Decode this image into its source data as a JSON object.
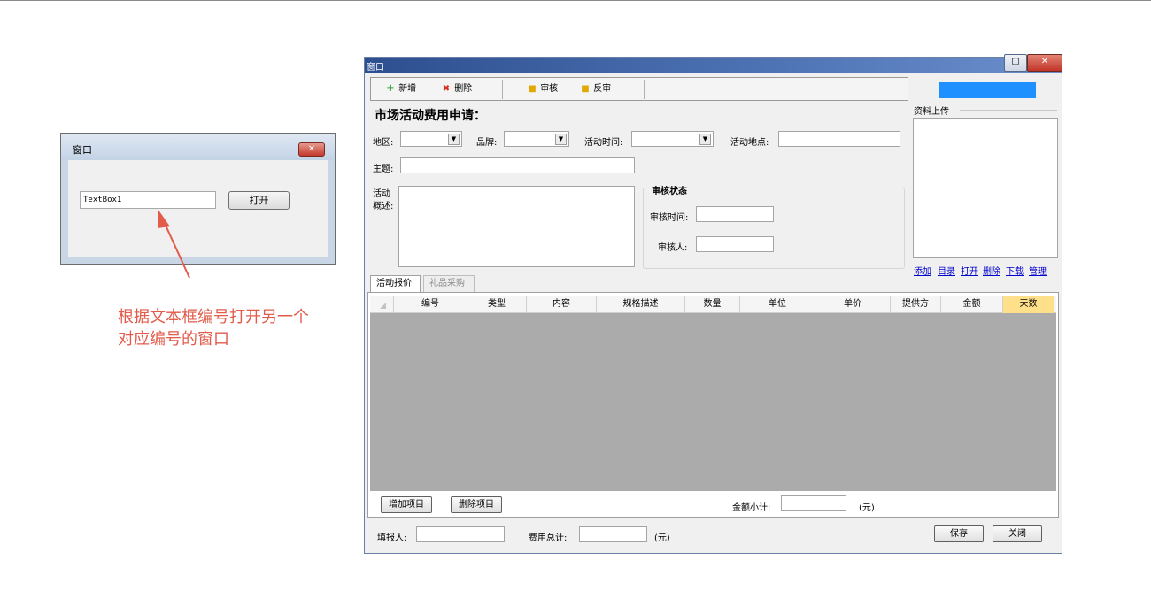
{
  "small_window": {
    "title": "窗口",
    "close": "✕",
    "textbox_value": "TextBox1",
    "open_button": "打开"
  },
  "annotation": {
    "line1": "根据文本框编号打开另一个",
    "line2": "对应编号的窗口",
    "color": "#e25b4b"
  },
  "main_window": {
    "title": "窗口",
    "max": "▢",
    "close": "✕",
    "toolbar": {
      "new": "新增",
      "delete": "删除",
      "audit": "审核",
      "unaudit": "反审"
    },
    "form_title": "市场活动费用申请：",
    "fields": {
      "region_label": "地区:",
      "brand_label": "品牌:",
      "time_label": "活动时间:",
      "place_label": "活动地点:",
      "subject_label": "主题:",
      "desc_label_1": "活动",
      "desc_label_2": "概述:"
    },
    "audit_group": {
      "title": "审核状态",
      "time_label": "审核时间:",
      "person_label": "审核人:"
    },
    "upload": {
      "label": "资料上传",
      "links": [
        "添加",
        "目录",
        "打开",
        "删除",
        "下载",
        "管理"
      ]
    },
    "tabs": [
      "活动报价",
      "礼品采购"
    ],
    "grid": {
      "columns": [
        "编号",
        "类型",
        "内容",
        "规格描述",
        "数量",
        "单位",
        "单价",
        "提供方",
        "金额",
        "天数"
      ]
    },
    "add_item": "增加项目",
    "delete_item": "删除项目",
    "subtotal_label": "金额小计:",
    "subtotal_unit": "(元)",
    "reporter_label": "填报人:",
    "total_label": "费用总计:",
    "total_unit": "(元)",
    "save": "保存",
    "close_btn": "关闭",
    "accent_blue": "#1e90ff",
    "header_highlight": "#ffe08a"
  }
}
